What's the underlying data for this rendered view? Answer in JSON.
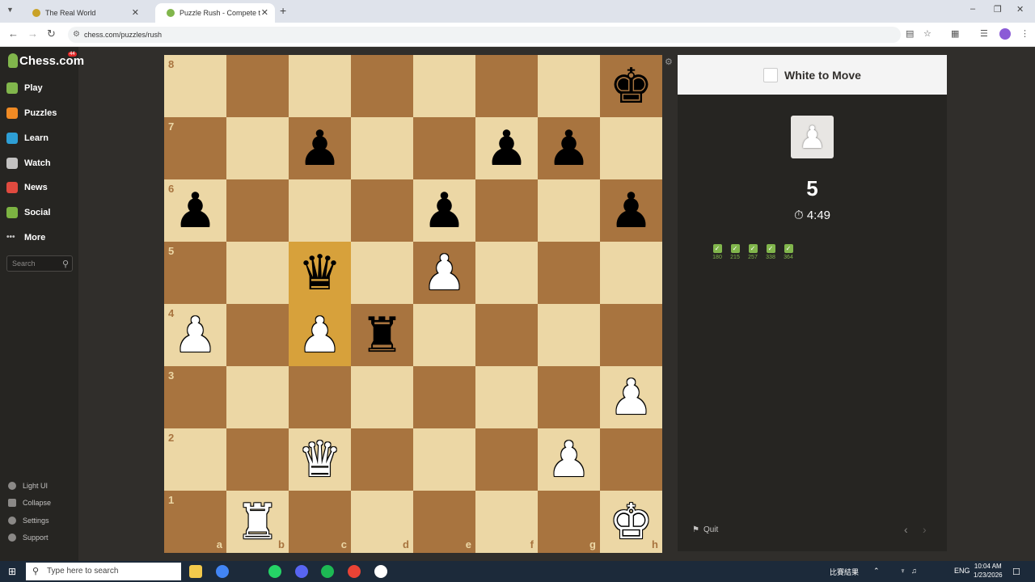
{
  "browser": {
    "tabs": [
      {
        "title": "The Real World",
        "active": false
      },
      {
        "title": "Puzzle Rush - Compete to S",
        "active": true
      }
    ],
    "url": "chess.com/puzzles/rush"
  },
  "sidebar": {
    "logo": "Chess.com",
    "badge": "44",
    "items": [
      {
        "label": "Play",
        "icon": "play-icon"
      },
      {
        "label": "Puzzles",
        "icon": "puzzle-icon"
      },
      {
        "label": "Learn",
        "icon": "learn-icon"
      },
      {
        "label": "Watch",
        "icon": "watch-icon"
      },
      {
        "label": "News",
        "icon": "news-icon"
      },
      {
        "label": "Social",
        "icon": "social-icon"
      },
      {
        "label": "More",
        "icon": "more-icon"
      }
    ],
    "search_placeholder": "Search",
    "bottom": [
      {
        "label": "Light UI"
      },
      {
        "label": "Collapse"
      },
      {
        "label": "Settings"
      },
      {
        "label": "Support"
      }
    ]
  },
  "board": {
    "ranks": [
      "8",
      "7",
      "6",
      "5",
      "4",
      "3",
      "2",
      "1"
    ],
    "files": [
      "a",
      "b",
      "c",
      "d",
      "e",
      "f",
      "g",
      "h"
    ],
    "light": "#ecd7a5",
    "dark": "#a8743f",
    "highlight": "#d7a13b",
    "highlight_squares": [
      "c5",
      "c4"
    ],
    "pieces": [
      {
        "sq": "h8",
        "type": "king",
        "color": "b"
      },
      {
        "sq": "c7",
        "type": "pawn",
        "color": "b"
      },
      {
        "sq": "f7",
        "type": "pawn",
        "color": "b"
      },
      {
        "sq": "g7",
        "type": "pawn",
        "color": "b"
      },
      {
        "sq": "a6",
        "type": "pawn",
        "color": "b"
      },
      {
        "sq": "e6",
        "type": "pawn",
        "color": "b"
      },
      {
        "sq": "h6",
        "type": "pawn",
        "color": "b"
      },
      {
        "sq": "c5",
        "type": "queen",
        "color": "b"
      },
      {
        "sq": "e5",
        "type": "pawn",
        "color": "w"
      },
      {
        "sq": "a4",
        "type": "pawn",
        "color": "w"
      },
      {
        "sq": "c4",
        "type": "pawn",
        "color": "w"
      },
      {
        "sq": "d4",
        "type": "rook",
        "color": "b"
      },
      {
        "sq": "h3",
        "type": "pawn",
        "color": "w"
      },
      {
        "sq": "c2",
        "type": "queen",
        "color": "w"
      },
      {
        "sq": "g2",
        "type": "pawn",
        "color": "w"
      },
      {
        "sq": "b1",
        "type": "rook",
        "color": "w"
      },
      {
        "sq": "h1",
        "type": "king",
        "color": "w"
      }
    ]
  },
  "panel": {
    "to_move": "White to Move",
    "score": "5",
    "timer": "4:49",
    "results": [
      "180",
      "215",
      "257",
      "338",
      "364"
    ],
    "quit": "Quit"
  },
  "taskbar": {
    "search_placeholder": "Type here to search",
    "tray_text": "比賽結果",
    "lang": "ENG",
    "time": "10:04 AM",
    "date": "1/23/2026"
  }
}
